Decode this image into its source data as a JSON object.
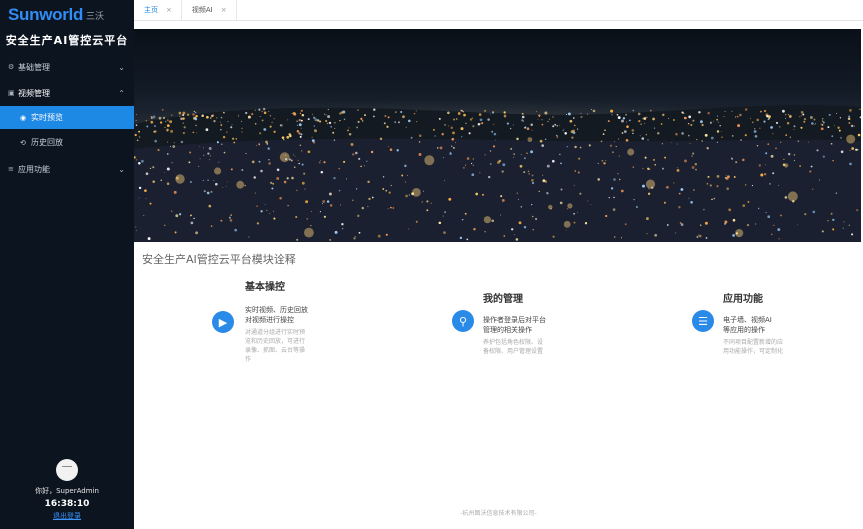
{
  "brand": {
    "logo": "Sunworld",
    "logo_sub": "三沃",
    "platform_title": "安全生产AI管控云平台"
  },
  "sidebar": {
    "items": [
      {
        "label": "基础管理",
        "icon": "settings-icon",
        "chevron": "⌄"
      },
      {
        "label": "视频管理",
        "icon": "video-icon",
        "chevron": "⌃",
        "children": [
          {
            "label": "实时预览",
            "icon": "camera-icon"
          },
          {
            "label": "历史回放",
            "icon": "history-icon"
          }
        ]
      },
      {
        "label": "应用功能",
        "icon": "list-icon",
        "chevron": "⌄"
      }
    ]
  },
  "user": {
    "greeting": "你好，SuperAdmin",
    "time": "16:38:10",
    "logout": "退出登录"
  },
  "tabs": [
    {
      "label": "主页",
      "close": "×"
    },
    {
      "label": "视频AI",
      "close": "×"
    }
  ],
  "section_title": "安全生产AI管控云平台模块诠释",
  "cards": [
    {
      "heading": "基本操控",
      "icon": "video-play-icon",
      "lines": [
        "实时视频、历史回放",
        "对视频进行操控"
      ],
      "desc": [
        "对通道分组进行实时预",
        "览和历史回放，可进行",
        "录像、抓图、云台等操",
        "作"
      ]
    },
    {
      "heading": "我的管理",
      "icon": "user-pin-icon",
      "lines": [
        "操作者登录后对平台",
        "管理的相关操作"
      ],
      "desc": [
        "养护包括角色权限、设",
        "备权限、用户管理设置"
      ]
    },
    {
      "heading": "应用功能",
      "icon": "menu-icon",
      "lines": [
        "电子墙、视频AI",
        "等应用的操作"
      ],
      "desc": [
        "不同项目配置新增的应",
        "用功能操作，可定制化"
      ]
    }
  ],
  "footer": "-杭州图沃信息技术有限公司-",
  "colors": {
    "sidebar_bg": "#0c1420",
    "accent": "#1e88e5"
  }
}
